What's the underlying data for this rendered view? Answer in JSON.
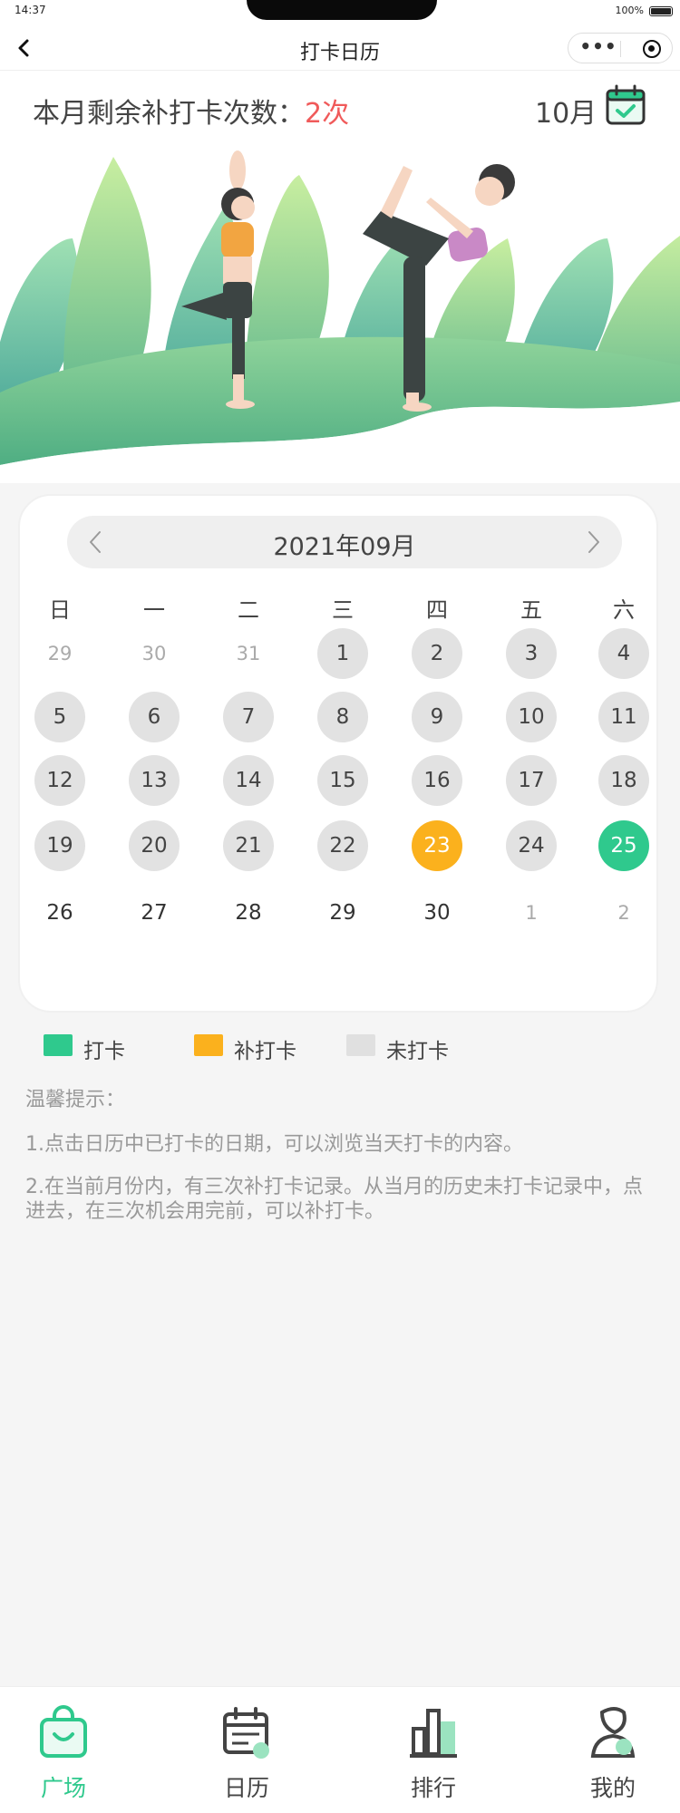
{
  "status_bar": {
    "time": "14:37",
    "battery": "100%"
  },
  "nav": {
    "title": "打卡日历",
    "more": "•••"
  },
  "top": {
    "remain_label": "本月剩余补打卡次数：",
    "remain_count": "2次",
    "month": "10月",
    "calendar_icon": "calendar-check-icon"
  },
  "calendar": {
    "title": "2021年09月",
    "prev": "‹",
    "next": "›",
    "weekdays": [
      "日",
      "一",
      "二",
      "三",
      "四",
      "五",
      "六"
    ],
    "weeks": [
      [
        {
          "d": "29",
          "s": "other"
        },
        {
          "d": "30",
          "s": "other"
        },
        {
          "d": "31",
          "s": "other"
        },
        {
          "d": "1",
          "s": "missed"
        },
        {
          "d": "2",
          "s": "missed"
        },
        {
          "d": "3",
          "s": "missed"
        },
        {
          "d": "4",
          "s": "missed"
        }
      ],
      [
        {
          "d": "5",
          "s": "missed"
        },
        {
          "d": "6",
          "s": "missed"
        },
        {
          "d": "7",
          "s": "missed"
        },
        {
          "d": "8",
          "s": "missed"
        },
        {
          "d": "9",
          "s": "missed"
        },
        {
          "d": "10",
          "s": "missed"
        },
        {
          "d": "11",
          "s": "missed"
        }
      ],
      [
        {
          "d": "12",
          "s": "missed"
        },
        {
          "d": "13",
          "s": "missed"
        },
        {
          "d": "14",
          "s": "missed"
        },
        {
          "d": "15",
          "s": "missed"
        },
        {
          "d": "16",
          "s": "missed"
        },
        {
          "d": "17",
          "s": "missed"
        },
        {
          "d": "18",
          "s": "missed"
        }
      ],
      [
        {
          "d": "19",
          "s": "missed"
        },
        {
          "d": "20",
          "s": "missed"
        },
        {
          "d": "21",
          "s": "missed"
        },
        {
          "d": "22",
          "s": "missed"
        },
        {
          "d": "23",
          "s": "makeup"
        },
        {
          "d": "24",
          "s": "missed"
        },
        {
          "d": "25",
          "s": "checked"
        }
      ],
      [
        {
          "d": "26",
          "s": "future"
        },
        {
          "d": "27",
          "s": "future"
        },
        {
          "d": "28",
          "s": "future"
        },
        {
          "d": "29",
          "s": "future"
        },
        {
          "d": "30",
          "s": "future"
        },
        {
          "d": "1",
          "s": "other"
        },
        {
          "d": "2",
          "s": "other"
        }
      ]
    ]
  },
  "legend": [
    {
      "label": "打卡",
      "color": "#2fc98d"
    },
    {
      "label": "补打卡",
      "color": "#fbb11d"
    },
    {
      "label": "未打卡",
      "color": "#e0e0e0"
    }
  ],
  "tips": {
    "title": "温馨提示：",
    "items": [
      "1.点击日历中已打卡的日期，可以浏览当天打卡的内容。",
      "2.在当前月份内，有三次补打卡记录。从当月的历史未打卡记录中，点进去，在三次机会用完前，可以补打卡。"
    ]
  },
  "tabs": [
    {
      "label": "广场",
      "icon": "shopping-bag-icon",
      "active": true
    },
    {
      "label": "日历",
      "icon": "calendar-icon",
      "active": false
    },
    {
      "label": "排行",
      "icon": "bar-chart-icon",
      "active": false
    },
    {
      "label": "我的",
      "icon": "profile-icon",
      "active": false
    }
  ],
  "colors": {
    "accent_green": "#2fc98d",
    "makeup_orange": "#fbb11d",
    "missed_grey": "#e2e2e2",
    "remain_red": "#f05a5a"
  }
}
